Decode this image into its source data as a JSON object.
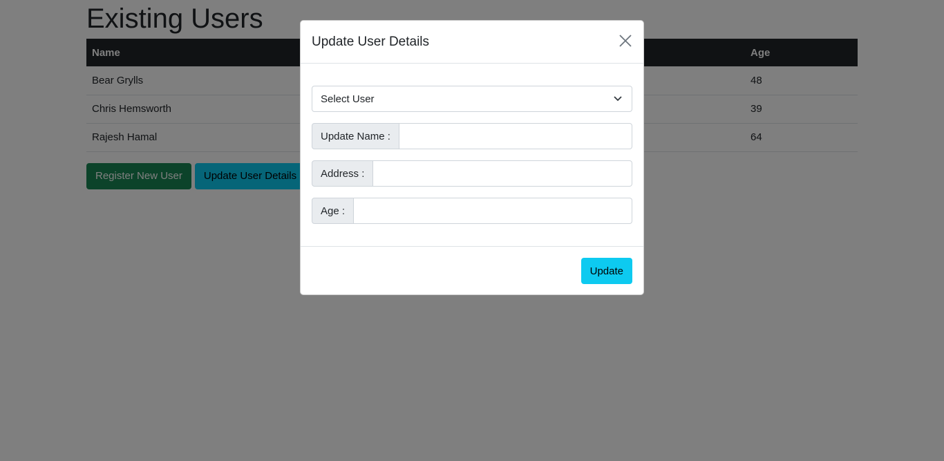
{
  "page": {
    "title": "Existing Users"
  },
  "table": {
    "headers": [
      "Name",
      "",
      "Age"
    ],
    "rows": [
      [
        "Bear Grylls",
        "",
        "48"
      ],
      [
        "Chris Hemsworth",
        "",
        "39"
      ],
      [
        "Rajesh Hamal",
        "",
        "64"
      ]
    ]
  },
  "buttons": {
    "register": "Register New User",
    "update_details": "Update User Details"
  },
  "modal": {
    "title": "Update User Details",
    "select_placeholder": "Select User",
    "name_label": "Update Name :",
    "address_label": "Address :",
    "age_label": "Age :",
    "update_button": "Update"
  },
  "colors": {
    "success": "#198754",
    "info": "#0dcaf0",
    "dark": "#212529"
  }
}
